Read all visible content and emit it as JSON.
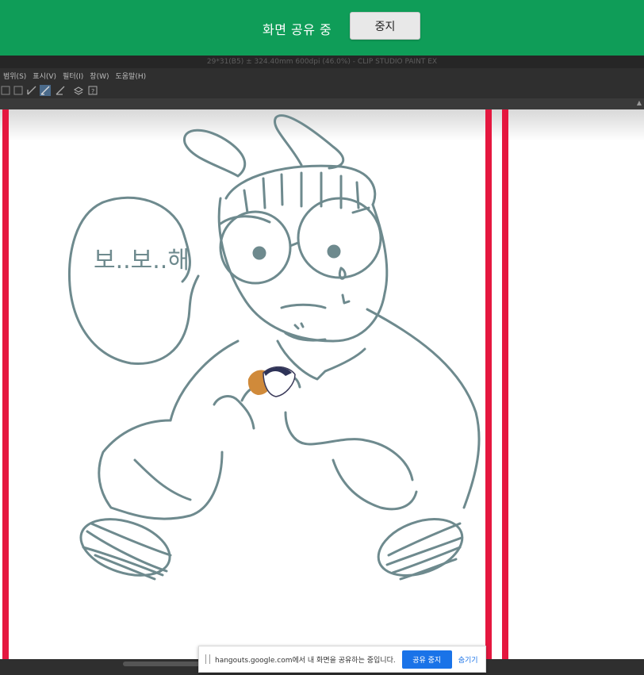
{
  "share_bar": {
    "status": "화면 공유 중",
    "stop_label": "중지",
    "color": "#0f9d58"
  },
  "app": {
    "title": "29*31(B5) ± 324.40mm 600dpi (46.0%) - CLIP STUDIO PAINT EX"
  },
  "menu": {
    "items": [
      "범위(S)",
      "표시(V)",
      "필터(I)",
      "창(W)",
      "도움말(H)"
    ]
  },
  "toolbar": {
    "icons": [
      "square-icon",
      "brush-icon",
      "pen-icon",
      "pencil-icon",
      "layer-icon",
      "help-icon"
    ]
  },
  "drawing": {
    "speech_text": "보..보..해",
    "stroke_color": "#6e8a8e"
  },
  "notification": {
    "text": "hangouts.google.com에서 내 화면을 공유하는 중입니다.",
    "stop_label": "공유 중지",
    "hide_label": "숨기기",
    "accent": "#1a73e8"
  }
}
